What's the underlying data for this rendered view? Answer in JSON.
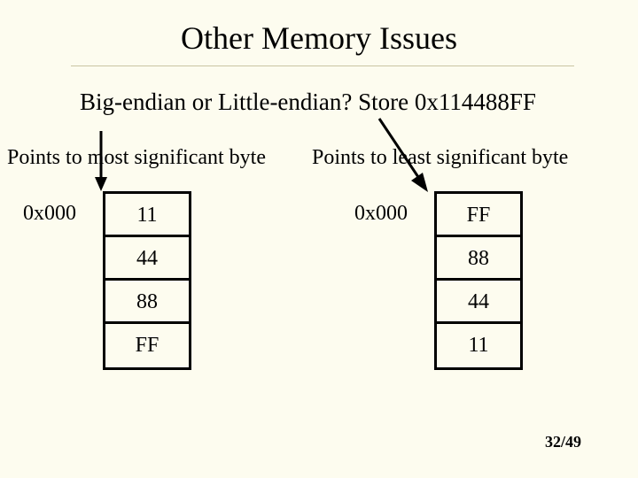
{
  "title": "Other Memory Issues",
  "subtitle": "Big-endian or Little-endian? Store 0x114488FF",
  "left": {
    "caption": "Points to most  significant byte",
    "addr": "0x000",
    "bytes": [
      "11",
      "44",
      "88",
      "FF"
    ]
  },
  "right": {
    "caption": "Points   to least significant byte",
    "addr": "0x000",
    "bytes": [
      "FF",
      "88",
      "44",
      "11"
    ]
  },
  "page": "32/49"
}
